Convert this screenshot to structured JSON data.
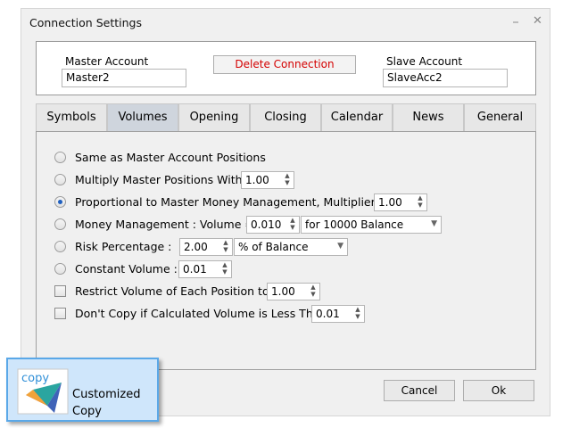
{
  "window": {
    "title": "Connection Settings",
    "minimize_glyph": "⎯",
    "close_glyph": "✕"
  },
  "accounts": {
    "master_label": "Master Account",
    "master_value": "Master2",
    "delete_label": "Delete Connection",
    "slave_label": "Slave Account",
    "slave_value": "SlaveAcc2"
  },
  "tabs": [
    {
      "label": "Symbols",
      "active": false
    },
    {
      "label": "Volumes",
      "active": true
    },
    {
      "label": "Opening",
      "active": false
    },
    {
      "label": "Closing",
      "active": false
    },
    {
      "label": "Calendar",
      "active": false
    },
    {
      "label": "News",
      "active": false
    },
    {
      "label": "General",
      "active": false
    }
  ],
  "volumes": {
    "same_as_master": {
      "label": "Same as Master Account Positions"
    },
    "multiply": {
      "label": "Multiply Master Positions With",
      "value": "1.00"
    },
    "proportional": {
      "label": "Proportional to Master Money Management, Multiplier :",
      "value": "1.00",
      "selected": true
    },
    "money_management": {
      "label": "Money Management : Volume =",
      "value": "0.010",
      "basis": "for 10000 Balance"
    },
    "risk_percentage": {
      "label": "Risk Percentage :",
      "value": "2.00",
      "basis": "% of Balance"
    },
    "constant_volume": {
      "label": "Constant Volume :",
      "value": "0.01"
    },
    "restrict_volume": {
      "label": "Restrict Volume of Each Position to",
      "value": "1.00",
      "checked": false
    },
    "dont_copy_less_than": {
      "label": "Don't Copy if Calculated Volume is Less Than",
      "value": "0.01",
      "checked": false
    }
  },
  "buttons": {
    "cancel": "Cancel",
    "ok": "Ok"
  },
  "logo": {
    "icon_word": "copy",
    "line1": "Customized",
    "line2": "Copy"
  },
  "icons": {
    "spin": "spin-up-down-icon",
    "dropdown": "chevron-down-icon"
  },
  "colors": {
    "accent_blue": "#5aa8e8",
    "delete_text": "#d40000",
    "active_tab": "#cfd5dd"
  }
}
